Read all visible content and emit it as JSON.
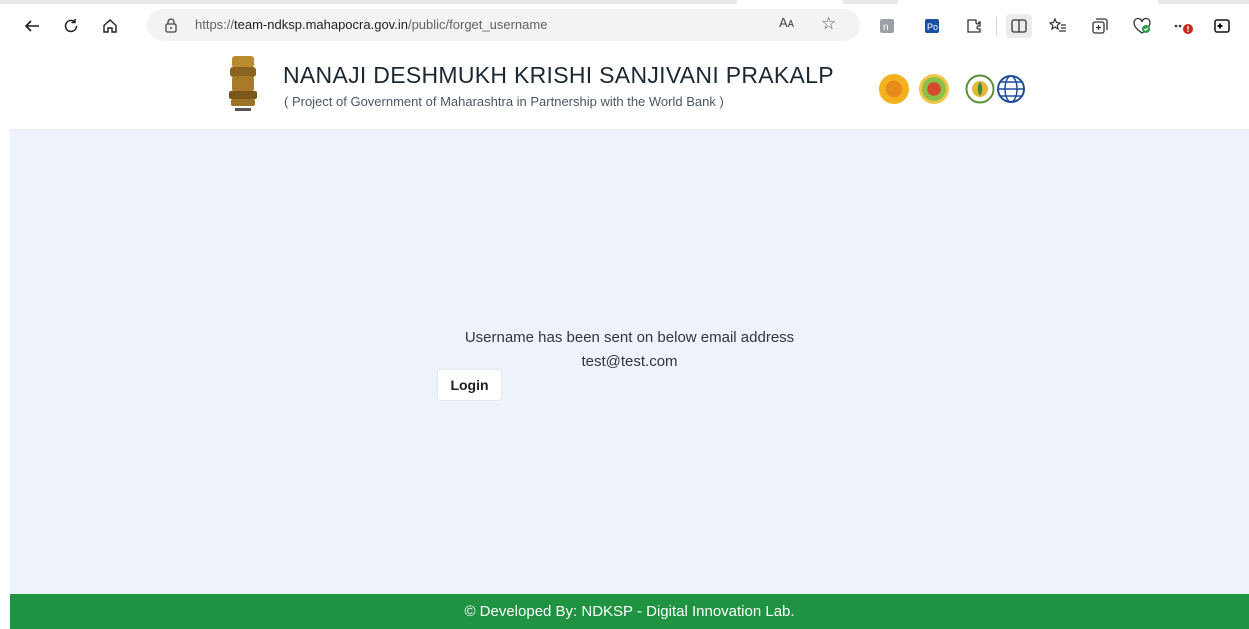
{
  "browser": {
    "url_prefix": "https://",
    "url_host": "team-ndksp.mahapocra.gov.in",
    "url_path": "/public/forget_username",
    "read_aloud": "Aᴀ",
    "icons": [
      "back-arrow-icon",
      "refresh-icon",
      "home-icon",
      "lock-icon",
      "read-aloud-icon",
      "favorite-star-icon",
      "extension-icon",
      "extension-icon",
      "extensions-puzzle-icon",
      "split-screen-icon",
      "favorites-icon",
      "collections-icon",
      "browser-essentials-icon",
      "more-menu-icon",
      "sidebar-icon"
    ]
  },
  "header": {
    "title": "NANAJI DESHMUKH KRISHI SANJIVANI PRAKALP",
    "subtitle": "( Project of Government of Maharashtra in Partnership with the World Bank )"
  },
  "main": {
    "message": "Username has been sent on below email address",
    "email": "test@test.com",
    "login_label": "Login"
  },
  "footer": {
    "text": "© Developed By: NDKSP - Digital Innovation Lab."
  },
  "colors": {
    "footer_green": "#1f9341",
    "main_bg": "#eef3fb",
    "header_text": "#1b2733"
  }
}
